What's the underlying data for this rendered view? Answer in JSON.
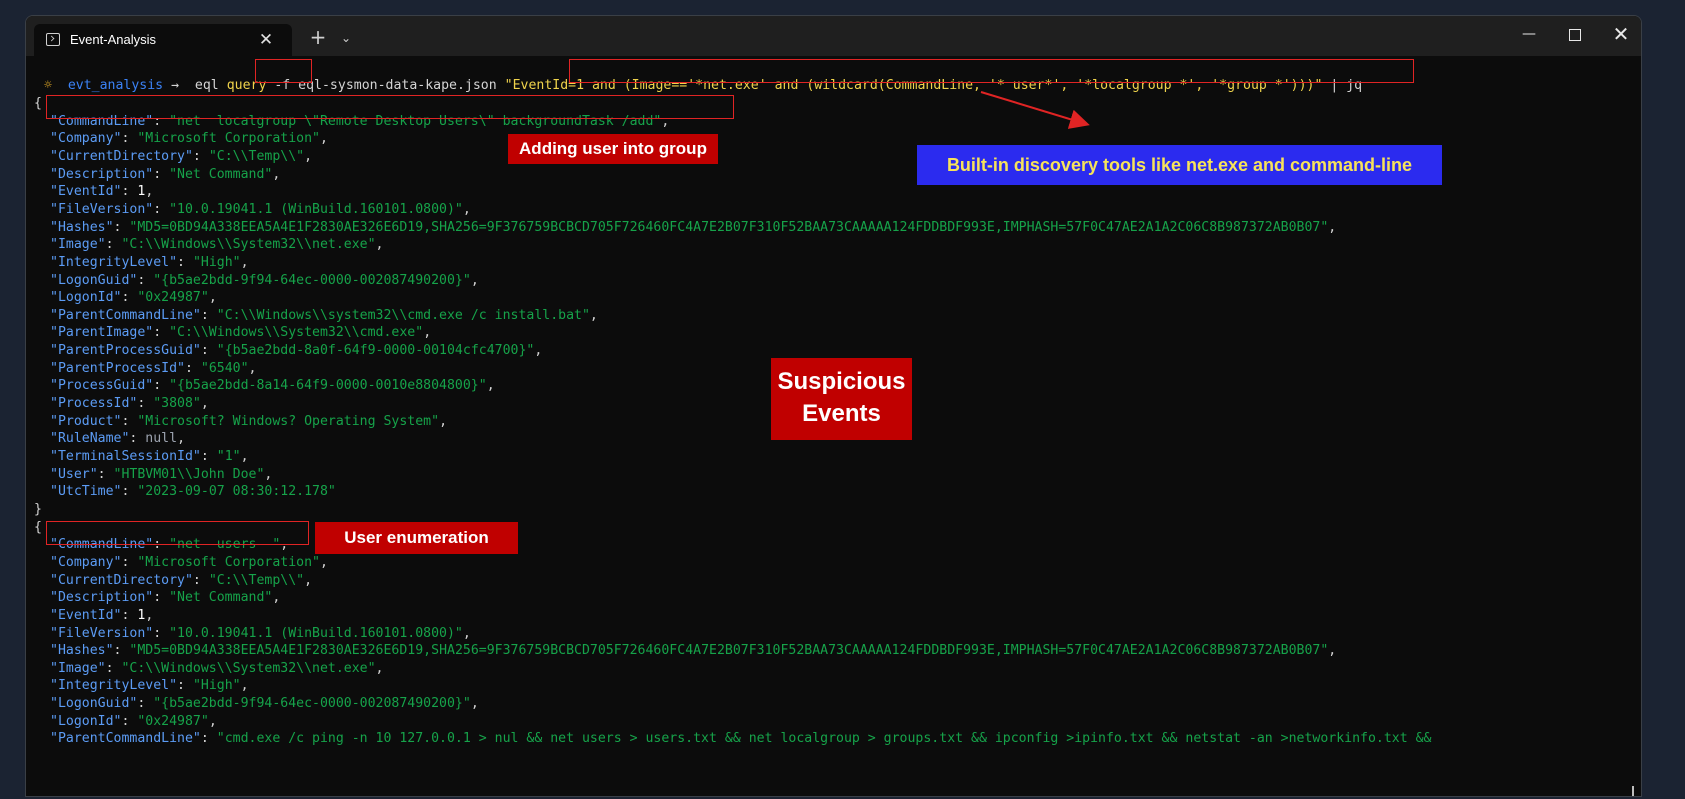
{
  "window": {
    "tab_title": "Event-Analysis",
    "close_tab_glyph": "✕",
    "new_tab_glyph": "+",
    "dropdown_glyph": "⌄",
    "minimize_glyph": "—",
    "close_glyph": "✕"
  },
  "prompt": {
    "icon": "☼",
    "dir": "evt_analysis",
    "arrow": "→",
    "cmd_eql": "eql",
    "cmd_query": "query",
    "cmd_args": "-f eql-sysmon-data-kape.json",
    "cmd_expr": "\"EventId=1 and (Image=='*net.exe' and (wildcard(CommandLine, '* user*', '*localgroup *', '*group *')))\"",
    "cmd_pipe": "| jq"
  },
  "event1": {
    "open": "{",
    "close": "}",
    "fields": [
      {
        "key": "\"CommandLine\"",
        "val": "\"net  localgroup \\\"Remote Desktop Users\\\" backgroundTask /add\""
      },
      {
        "key": "\"Company\"",
        "val": "\"Microsoft Corporation\""
      },
      {
        "key": "\"CurrentDirectory\"",
        "val": "\"C:\\\\Temp\\\\\""
      },
      {
        "key": "\"Description\"",
        "val": "\"Net Command\""
      },
      {
        "key": "\"EventId\"",
        "val": "1"
      },
      {
        "key": "\"FileVersion\"",
        "val": "\"10.0.19041.1 (WinBuild.160101.0800)\""
      },
      {
        "key": "\"Hashes\"",
        "val": "\"MD5=0BD94A338EEA5A4E1F2830AE326E6D19,SHA256=9F376759BCBCD705F726460FC4A7E2B07F310F52BAA73CAAAAA124FDDBDF993E,IMPHASH=57F0C47AE2A1A2C06C8B987372AB0B07\""
      },
      {
        "key": "\"Image\"",
        "val": "\"C:\\\\Windows\\\\System32\\\\net.exe\""
      },
      {
        "key": "\"IntegrityLevel\"",
        "val": "\"High\""
      },
      {
        "key": "\"LogonGuid\"",
        "val": "\"{b5ae2bdd-9f94-64ec-0000-002087490200}\""
      },
      {
        "key": "\"LogonId\"",
        "val": "\"0x24987\""
      },
      {
        "key": "\"ParentCommandLine\"",
        "val": "\"C:\\\\Windows\\\\system32\\\\cmd.exe /c install.bat\""
      },
      {
        "key": "\"ParentImage\"",
        "val": "\"C:\\\\Windows\\\\System32\\\\cmd.exe\""
      },
      {
        "key": "\"ParentProcessGuid\"",
        "val": "\"{b5ae2bdd-8a0f-64f9-0000-00104cfc4700}\""
      },
      {
        "key": "\"ParentProcessId\"",
        "val": "\"6540\""
      },
      {
        "key": "\"ProcessGuid\"",
        "val": "\"{b5ae2bdd-8a14-64f9-0000-0010e8804800}\""
      },
      {
        "key": "\"ProcessId\"",
        "val": "\"3808\""
      },
      {
        "key": "\"Product\"",
        "val": "\"Microsoft? Windows? Operating System\""
      },
      {
        "key": "\"RuleName\"",
        "val": "null"
      },
      {
        "key": "\"TerminalSessionId\"",
        "val": "\"1\""
      },
      {
        "key": "\"User\"",
        "val": "\"HTBVM01\\\\John Doe\""
      },
      {
        "key": "\"UtcTime\"",
        "val": "\"2023-09-07 08:30:12.178\""
      }
    ]
  },
  "event2": {
    "open": "{",
    "fields": [
      {
        "key": "\"CommandLine\"",
        "val": "\"net  users  \""
      },
      {
        "key": "\"Company\"",
        "val": "\"Microsoft Corporation\""
      },
      {
        "key": "\"CurrentDirectory\"",
        "val": "\"C:\\\\Temp\\\\\""
      },
      {
        "key": "\"Description\"",
        "val": "\"Net Command\""
      },
      {
        "key": "\"EventId\"",
        "val": "1"
      },
      {
        "key": "\"FileVersion\"",
        "val": "\"10.0.19041.1 (WinBuild.160101.0800)\""
      },
      {
        "key": "\"Hashes\"",
        "val": "\"MD5=0BD94A338EEA5A4E1F2830AE326E6D19,SHA256=9F376759BCBCD705F726460FC4A7E2B07F310F52BAA73CAAAAA124FDDBDF993E,IMPHASH=57F0C47AE2A1A2C06C8B987372AB0B07\""
      },
      {
        "key": "\"Image\"",
        "val": "\"C:\\\\Windows\\\\System32\\\\net.exe\""
      },
      {
        "key": "\"IntegrityLevel\"",
        "val": "\"High\""
      },
      {
        "key": "\"LogonGuid\"",
        "val": "\"{b5ae2bdd-9f94-64ec-0000-002087490200}\""
      },
      {
        "key": "\"LogonId\"",
        "val": "\"0x24987\""
      },
      {
        "key": "\"ParentCommandLine\"",
        "val": "\"cmd.exe /c ping -n 10 127.0.0.1 > nul && net users > users.txt && net localgroup > groups.txt && ipconfig >ipinfo.txt && netstat -an >networkinfo.txt &&"
      }
    ]
  },
  "annotations": {
    "adding_user": "Adding user into group",
    "builtin_tools": "Built-in discovery tools like net.exe and command-line",
    "suspicious_1": "Suspicious",
    "suspicious_2": "Events",
    "user_enum": "User enumeration"
  },
  "colors": {
    "terminal_bg": "#0c0c0c",
    "key": "#5c9cf5",
    "string": "#16a34a",
    "highlight_red": "#e02424",
    "label_red": "#c00000",
    "label_blue": "#2b2bef",
    "query_yellow": "#f0d44c"
  }
}
